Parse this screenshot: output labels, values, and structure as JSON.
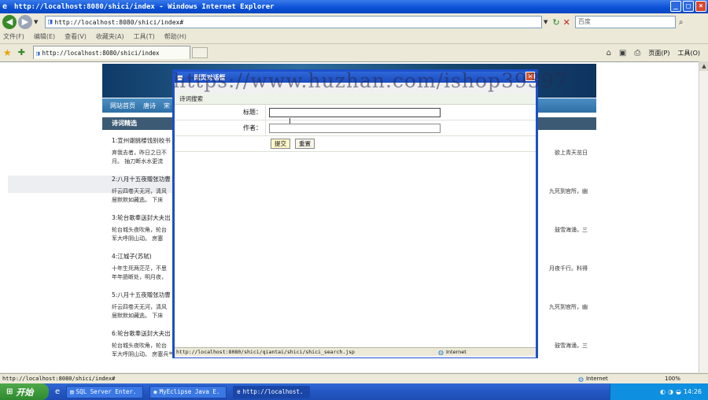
{
  "window": {
    "title": "http://localhost:8080/shici/index - Windows Internet Explorer"
  },
  "address": {
    "url": "http://localhost:8080/shici/index#",
    "search_placeholder": "百度"
  },
  "menu": [
    "文件(F)",
    "编辑(E)",
    "查看(V)",
    "收藏夹(A)",
    "工具(T)",
    "帮助(H)"
  ],
  "tab": {
    "label": "http://localhost:8080/shici/index"
  },
  "commands": {
    "page": "页面(P)",
    "tools": "工具(O)"
  },
  "site": {
    "nav": [
      "网站首页",
      "唐诗",
      "宋"
    ],
    "section_title": "诗词精选",
    "poems": [
      {
        "title": "1:宣州谢朓楼饯别校书",
        "text": "弃我去者，昨日之日不",
        "tail": "欲上青天览日",
        "tail2": "月。 抽刀断水水更流"
      },
      {
        "title": "2:八月十五夜赠张功曹",
        "text": "纤云四卷天无河，清风",
        "tail": "九死到官所，幽",
        "tail2": "居默默如藏逃。 下床"
      },
      {
        "title": "3:轮台歌奉送封大夫出",
        "text": "轮台城头夜吹角，轮台",
        "tail": "鼓雪海涌，三",
        "tail2": "军大呼阴山动。 房塞"
      },
      {
        "title": "4:江城子(苏轼)",
        "text": "十年生死两茫茫，不思",
        "tail": "月夜千行。料得",
        "tail2": "年年肠断处，明月夜，"
      },
      {
        "title": "5:八月十五夜赠张功曹",
        "text": "纤云四卷天无河，清风",
        "tail": "九死到官所，幽",
        "tail2": "居默默如藏逃。 下床"
      },
      {
        "title": "6:轮台歌奉送封大夫出",
        "text": "轮台城头夜吹角，轮台",
        "tail": "鼓雪海涌，三",
        "tail2": "军大呼阴山动。 房塞兵气连云屯，战场白骨缠草根。 剑河风急云片阔，沙口石冻马蹄脱。 亚相勤王甘苦辛，誓将报主静边尘。 古来青史谁不见，今见功名胜古人。"
      }
    ]
  },
  "dialog": {
    "title": "网页对话框",
    "form_heading": "诗词搜索",
    "label_title": "标题：",
    "label_author": "作者：",
    "submit": "提交",
    "reset": "重置",
    "status_url": "http://localhost:8080/shici/qiantai/shici/shici_search.jsp",
    "status_zone": "Internet"
  },
  "watermark": "https://www.huzhan.com/ishop39397",
  "statusbar": {
    "url": "http://localhost:8080/shici/index#",
    "zone": "Internet",
    "zoom": "100%"
  },
  "taskbar": {
    "start": "开始",
    "tasks": [
      "SQL Server Enter.",
      "MyEclipse Java E.",
      "http://localhost."
    ],
    "clock": "14:26"
  }
}
